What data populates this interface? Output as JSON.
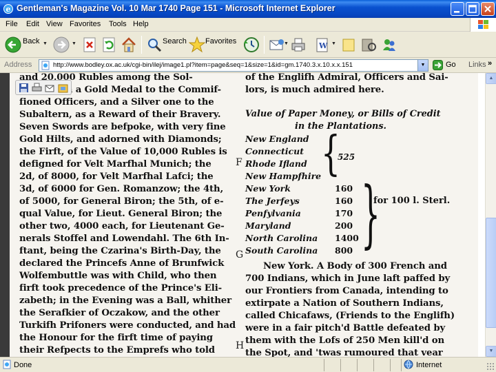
{
  "window": {
    "title": "Gentleman's Magazine Vol. 10 Mar 1740 Page 151 - Microsoft Internet Explorer",
    "controls": [
      "minimize",
      "maximize",
      "close"
    ]
  },
  "menu": [
    "File",
    "Edit",
    "View",
    "Favorites",
    "Tools",
    "Help"
  ],
  "toolbar": {
    "back_label": "Back",
    "search_label": "Search",
    "favorites_label": "Favorites"
  },
  "address": {
    "label": "Address",
    "url": "http://www.bodley.ox.ac.uk/cgi-bin/ilej/image1.pl?item=page&seq=1&size=1&id=gm.1740.3.x.10.x.x.151",
    "go_label": "Go",
    "links_label": "Links",
    "chevron": "»"
  },
  "document": {
    "col1_lines": [
      "and 20,000 Rubles among the Sol-",
      "diers, with a Gold Medal to the Commif-",
      "fioned Officers, and a Silver one to the",
      "Subaltern, as a Reward of their Bravery.",
      "Seven Swords are befpoke, with very fine",
      "Gold Hilts, and adorned with Diamonds;",
      "the Firft, of the Value of 10,000 Rubles is",
      "defigned for Velt Marfhal Munich; the",
      "2d, of 8000, for Velt Marfhal Lafci; the",
      "3d, of 6000 for Gen. Romanzow; the 4th,",
      "of 5000, for General Biron; the 5th, of e-",
      "qual Value, for Lieut. General Biron; the",
      "other two, 4000 each, for Lieutenant Ge-",
      "nerals Stoffel and Lowendahl. The 6th In-",
      "ftant, being the Czarina's Birth-Day, the",
      "declared the Princefs Anne of Brunfwick",
      "Wolfembuttle was with Child, who then",
      "firft took precedence of the Prince's Eli-",
      "zabeth; in the Evening was a Ball, whither",
      "the Serafkier of Oczakow, and the other",
      "Turkifh Prifoners were conducted, and had",
      "the Honour for the firft time of paying",
      "their Refpects to the Emprefs who told"
    ],
    "col2_top_lines": [
      "of the Englifh Admiral, Officers and Sai-",
      "lors, is much admired here."
    ],
    "heading_line1": "Value of Paper Money, or Bills of Credit",
    "heading_line2": "in the Plantations.",
    "rows": [
      {
        "name": "New England",
        "value": ""
      },
      {
        "name": "Connecticut",
        "value": ""
      },
      {
        "name": "Rhode Ifland",
        "value": ""
      },
      {
        "name": "New Hampfhire",
        "value": ""
      },
      {
        "name": "New York",
        "value": "160"
      },
      {
        "name": "The Jerfeys",
        "value": "160"
      },
      {
        "name": "Penfylvania",
        "value": "170"
      },
      {
        "name": "Maryland",
        "value": "200"
      },
      {
        "name": "North Carolina",
        "value": "1400"
      },
      {
        "name": "South Carolina",
        "value": "800"
      }
    ],
    "brace1_value": "525",
    "brace2_label": "for 100 l. Sterl.",
    "col2_bottom_lines": [
      "New York. A Body of 300 French and",
      "700 Indians, which in June laft paffed by",
      "our Frontiers from Canada, intending to",
      "extirpate a Nation of Southern Indians,",
      "called Chicafaws, (Friends to the Englifh)",
      "were in a fair pitch'd Battle defeated by",
      "them with the Lofs of 250 Men kill'd on",
      "the Spot, and 'twas rumoured that vear"
    ],
    "margin_letters": [
      "F",
      "G",
      "H"
    ]
  },
  "status": {
    "text": "Done",
    "zone": "Internet"
  },
  "colors": {
    "titlebar": "#0a52d0",
    "chrome": "#ece9d8",
    "scan_paper": "#f6f4ef"
  }
}
